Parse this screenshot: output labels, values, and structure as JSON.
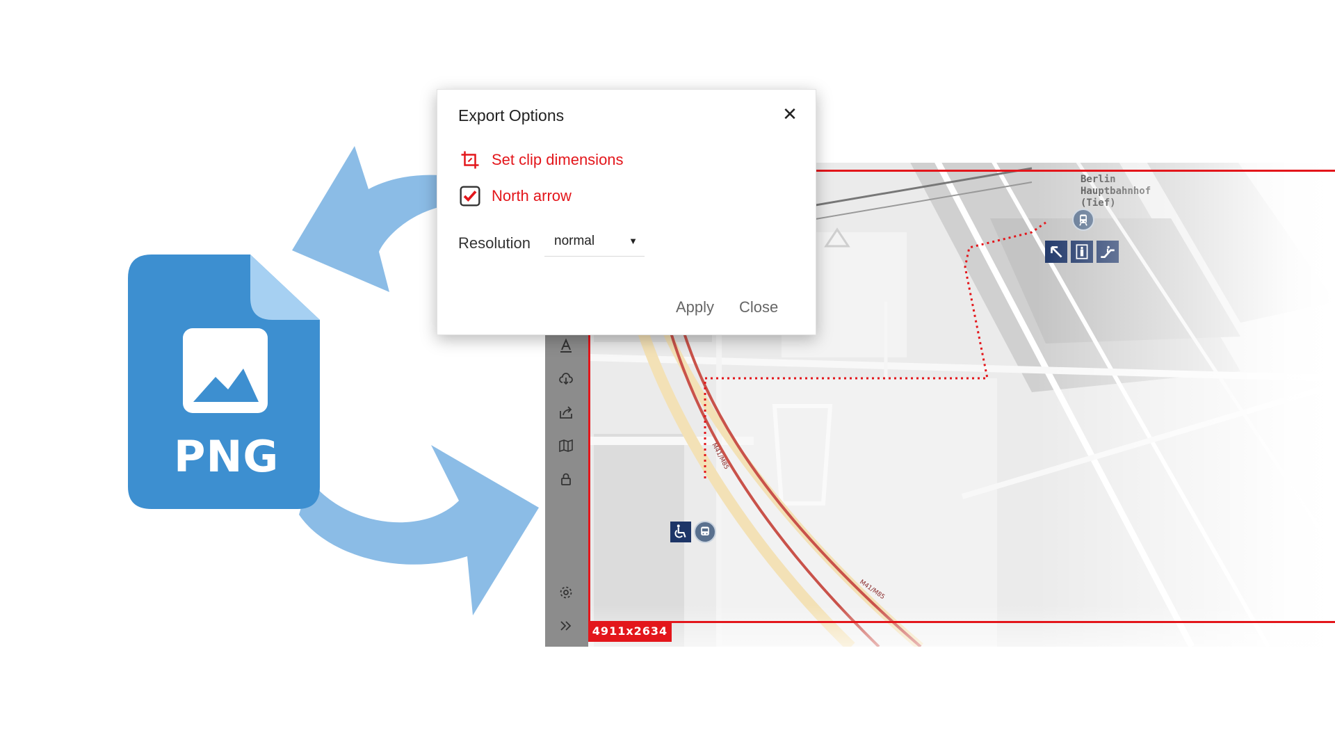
{
  "png_badge": {
    "label": "PNG",
    "icon": "image-icon",
    "color": "#3d8fd0"
  },
  "dialog": {
    "title": "Export Options",
    "close_icon": "close-icon",
    "options": [
      {
        "label": "Set clip dimensions",
        "icon": "crop-icon"
      },
      {
        "label": "North arrow",
        "icon": "checkbox-checked-icon",
        "checked": true
      }
    ],
    "resolution": {
      "label": "Resolution",
      "value": "normal"
    },
    "apply_label": "Apply",
    "close_label": "Close",
    "accent": "#e3161b"
  },
  "map": {
    "station_label": "Berlin\nHauptbahnhof\n(Tief)",
    "clip_dimensions": "4911x2634",
    "route_labels": [
      "M41/M85",
      "M41/M85"
    ],
    "sidebar_icons": [
      "text-icon",
      "cloud-download-icon",
      "share-icon",
      "map-icon",
      "lock-icon",
      "gear-icon",
      "expand-icon"
    ],
    "poi_icons": [
      "tram-icon",
      "exit-icon",
      "elevator-icon",
      "escalator-icon",
      "wheelchair-icon",
      "bus-icon"
    ]
  }
}
